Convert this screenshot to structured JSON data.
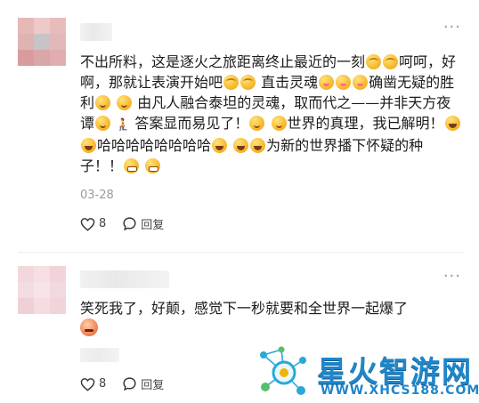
{
  "comments": [
    {
      "text": {
        "seg1": "不出所料，这是逐火之旅距离终止最近的一刻",
        "seg2": "呵呵，好啊，那就让表演开始吧",
        "seg3": "直击灵魂",
        "seg4": "确凿无疑的胜利",
        "seg5": "由凡人融合泰坦的灵魂，取而代之——并非天方夜谭",
        "seg6": "答案显而易见了！",
        "seg7": "世界的真理，我已解明！",
        "seg8": "哈哈哈哈哈哈哈哈",
        "seg9": "为新的世界播下怀疑的种子！！"
      },
      "date": "03-28",
      "like_count": "8",
      "reply_label": "回复"
    },
    {
      "text": {
        "seg1": "笑死我了，好颠，感觉下一秒就要和全世界一起爆了"
      },
      "like_count": "8",
      "reply_label": "回复"
    }
  ],
  "watermark": {
    "title": "星火智游网",
    "url": "WWW.XHCS188.COM"
  },
  "icons": {
    "more": "more-dots-icon",
    "like": "heart-icon",
    "reply": "speech-bubble-icon"
  },
  "colors": {
    "accent": "#1f86c9",
    "muted_text": "#9a9a9a"
  }
}
